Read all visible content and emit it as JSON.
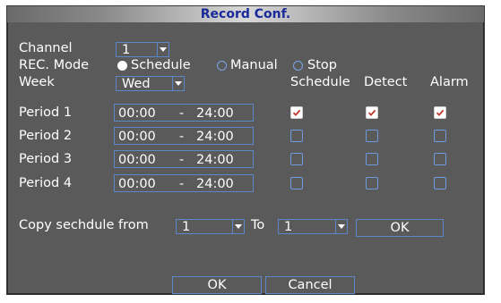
{
  "dialog": {
    "title": "Record Conf."
  },
  "channel": {
    "label": "Channel",
    "value": "1"
  },
  "rec_mode": {
    "label": "REC. Mode",
    "options": [
      "Schedule",
      "Manual",
      "Stop"
    ],
    "selected": "Schedule"
  },
  "week": {
    "label": "Week",
    "value": "Wed"
  },
  "columns": [
    "Schedule",
    "Detect",
    "Alarm"
  ],
  "time_separator": "-",
  "periods": [
    {
      "label": "Period 1",
      "start": "00:00",
      "end": "24:00",
      "schedule": true,
      "detect": true,
      "alarm": true
    },
    {
      "label": "Period 2",
      "start": "00:00",
      "end": "24:00",
      "schedule": false,
      "detect": false,
      "alarm": false
    },
    {
      "label": "Period 3",
      "start": "00:00",
      "end": "24:00",
      "schedule": false,
      "detect": false,
      "alarm": false
    },
    {
      "label": "Period 4",
      "start": "00:00",
      "end": "24:00",
      "schedule": false,
      "detect": false,
      "alarm": false
    }
  ],
  "copy": {
    "label": "Copy sechdule from",
    "from_value": "1",
    "to_label": "To",
    "to_value": "1",
    "ok_label": "OK"
  },
  "buttons": {
    "ok": "OK",
    "cancel": "Cancel"
  },
  "colors": {
    "accent_border": "#5b86c7",
    "title_text": "#1a2a9a",
    "check_mark": "#c0392b"
  }
}
